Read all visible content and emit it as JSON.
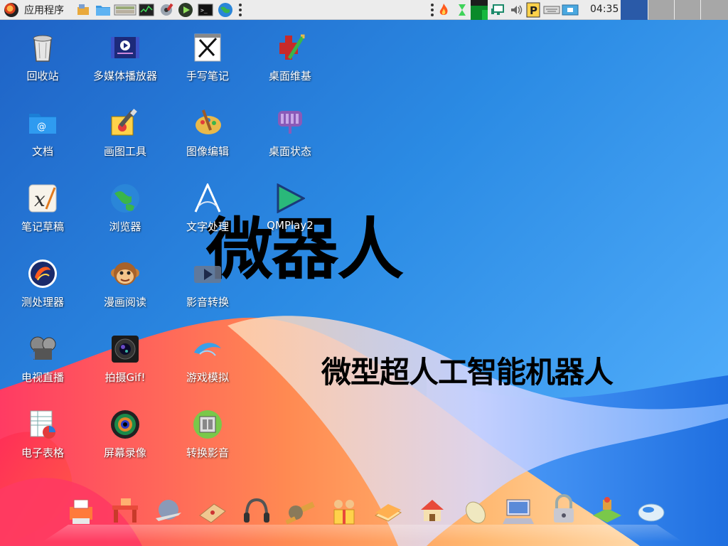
{
  "panel": {
    "menu_label": "应用程序",
    "launchers": [
      {
        "icon": "folder-settings-icon"
      },
      {
        "icon": "folder-icon"
      },
      {
        "icon": "image-viewer-icon"
      },
      {
        "icon": "system-monitor-icon"
      },
      {
        "icon": "tools-icon"
      },
      {
        "icon": "media-player-icon"
      },
      {
        "icon": "terminal-icon"
      },
      {
        "icon": "browser-icon"
      }
    ],
    "tray": [
      {
        "icon": "fire-icon"
      },
      {
        "icon": "hourglass-icon"
      },
      {
        "icon": "cpu-graph-icon"
      },
      {
        "icon": "network-icon"
      },
      {
        "icon": "volume-icon"
      },
      {
        "icon": "parking-icon"
      },
      {
        "icon": "keyboard-icon"
      },
      {
        "icon": "screenshot-icon"
      }
    ],
    "clock": "04:35"
  },
  "desktop_icons": [
    {
      "label": "回收站",
      "icon": "trash-icon"
    },
    {
      "label": "多媒体播放器",
      "icon": "media-player-icon"
    },
    {
      "label": "手写笔记",
      "icon": "handwriting-notes-icon"
    },
    {
      "label": "桌面维基",
      "icon": "wiki-icon"
    },
    {
      "label": "文档",
      "icon": "documents-folder-icon"
    },
    {
      "label": "画图工具",
      "icon": "paint-icon"
    },
    {
      "label": "图像编辑",
      "icon": "image-editor-icon"
    },
    {
      "label": "桌面状态",
      "icon": "desktop-status-icon"
    },
    {
      "label": "笔记草稿",
      "icon": "draft-notes-icon"
    },
    {
      "label": "浏览器",
      "icon": "browser-icon"
    },
    {
      "label": "文字处理",
      "icon": "word-processor-icon"
    },
    {
      "label": "QMPlay2",
      "icon": "qmplay2-icon"
    },
    {
      "label": "测处理器",
      "icon": "processor-test-icon"
    },
    {
      "label": "漫画阅读",
      "icon": "comic-reader-icon"
    },
    {
      "label": "影音转换",
      "icon": "video-convert-icon"
    },
    {
      "label": "电视直播",
      "icon": "tv-live-icon"
    },
    {
      "label": "拍摄Gif!",
      "icon": "gif-camera-icon"
    },
    {
      "label": "游戏模拟",
      "icon": "game-emulator-icon"
    },
    {
      "label": "电子表格",
      "icon": "spreadsheet-icon"
    },
    {
      "label": "屏幕录像",
      "icon": "screen-recorder-icon"
    },
    {
      "label": "转换影音",
      "icon": "media-converter-icon"
    }
  ],
  "wallpaper": {
    "title": "微器人",
    "subtitle": "微型超人工智能机器人"
  },
  "dock": [
    {
      "icon": "dock-printer-icon"
    },
    {
      "icon": "dock-desk-icon"
    },
    {
      "icon": "dock-globe-plane-icon"
    },
    {
      "icon": "dock-board-icon"
    },
    {
      "icon": "dock-headphones-icon"
    },
    {
      "icon": "dock-satellite-icon"
    },
    {
      "icon": "dock-gift-people-icon"
    },
    {
      "icon": "dock-books-icon"
    },
    {
      "icon": "dock-house-icon"
    },
    {
      "icon": "dock-mouse-icon"
    },
    {
      "icon": "dock-computer-icon"
    },
    {
      "icon": "dock-lock-icon"
    },
    {
      "icon": "dock-map-icon"
    },
    {
      "icon": "dock-mouse-device-icon"
    }
  ],
  "colors": {
    "panel_bg": "#ececec",
    "accent_blue": "#2b8be4",
    "wave_orange": "#ff9a4a",
    "wave_red": "#ff3a60"
  }
}
